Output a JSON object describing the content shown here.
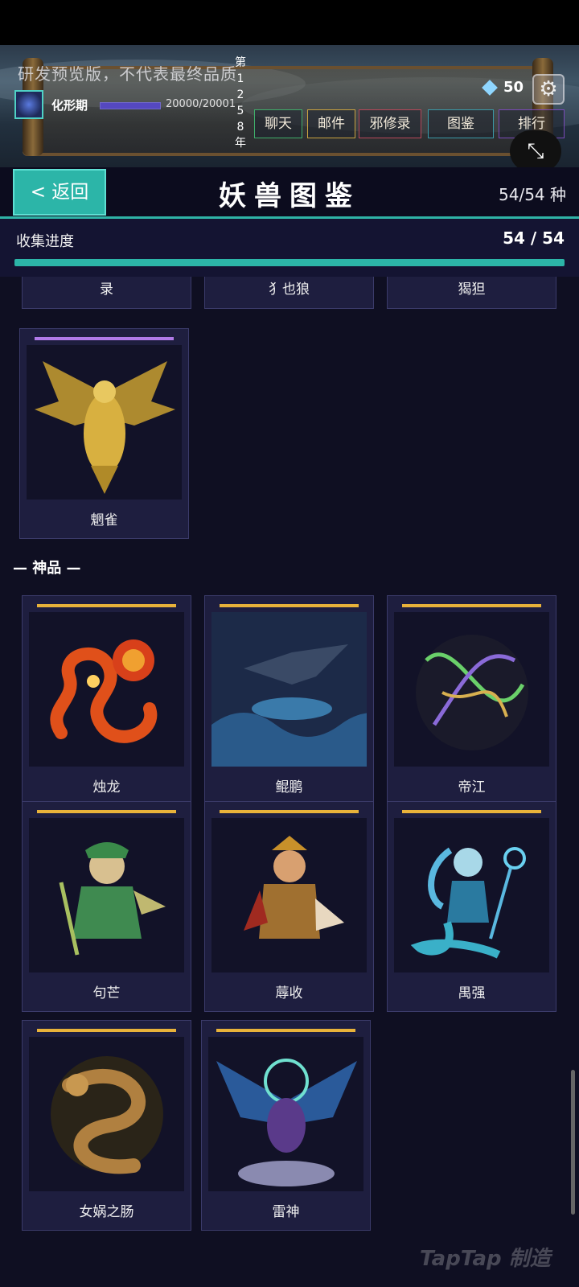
{
  "banner": {
    "preview_notice": "研发预览版，不代表最终品质",
    "realm": "化形期",
    "exp_text": "20000/20001",
    "exp_fraction": 0.99995,
    "year_text": "第\n1\n2\n5\n8\n年",
    "gems": "50",
    "menu": {
      "chat": "聊天",
      "mail": "邮件",
      "evil_record": "邪修录",
      "atlas": "图鉴",
      "ranking": "排行"
    }
  },
  "header": {
    "back_label": "< 返回",
    "title": "妖兽图鉴",
    "species_count": "54/54 种"
  },
  "progress": {
    "label": "收集进度",
    "value": "54 / 54",
    "fraction": 1.0
  },
  "partial_row": [
    "录",
    "犭也狼",
    "猲狚"
  ],
  "single_card": {
    "name": "魍雀",
    "stripe_color": "#b07ae8"
  },
  "divine_section": {
    "title": "— 神品 —",
    "stripe_color": "#e8b23a",
    "cards": [
      "烛龙",
      "鲲鹏",
      "帝江",
      "句芒",
      "蓐收",
      "禺强",
      "女娲之肠",
      "雷神"
    ]
  },
  "watermark": "TapTap 制造"
}
